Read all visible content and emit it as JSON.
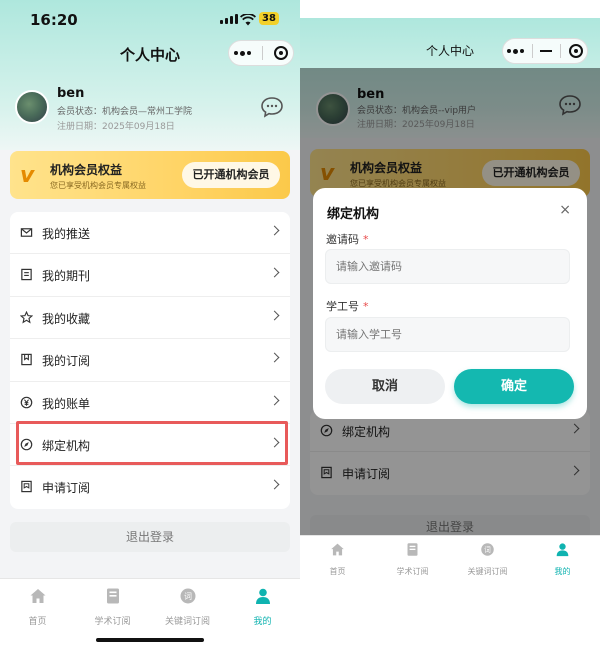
{
  "status_bar": {
    "time": "16:20",
    "battery": "38"
  },
  "header": {
    "title": "个人中心"
  },
  "profile": {
    "name": "ben",
    "member_status_left": "会员状态：机构会员—常州工学院",
    "member_status_right": "会员状态：机构会员--vip用户",
    "register_date": "注册日期：2025年09月18日"
  },
  "vip_card": {
    "logo": "v",
    "title": "机构会员权益",
    "subtitle": "您已享受机构会员专属权益",
    "button": "已开通机构会员"
  },
  "menu": {
    "items": [
      {
        "label": "我的推送",
        "icon": "mail-icon"
      },
      {
        "label": "我的期刊",
        "icon": "book-icon"
      },
      {
        "label": "我的收藏",
        "icon": "star-icon"
      },
      {
        "label": "我的订阅",
        "icon": "bookmark-icon"
      },
      {
        "label": "我的账单",
        "icon": "yuan-icon"
      },
      {
        "label": "绑定机构",
        "icon": "compass-icon"
      },
      {
        "label": "申请订阅",
        "icon": "apply-icon"
      }
    ]
  },
  "logout": "退出登录",
  "tabbar": {
    "items": [
      {
        "label": "首页",
        "icon": "home-icon"
      },
      {
        "label": "学术订阅",
        "icon": "document-icon"
      },
      {
        "label": "关键词订阅",
        "icon": "keyword-icon"
      },
      {
        "label": "我的",
        "icon": "user-icon"
      }
    ]
  },
  "modal": {
    "title": "绑定机构",
    "close": "×",
    "invite_label": "邀请码",
    "invite_placeholder": "请输入邀请码",
    "student_label": "学工号",
    "student_placeholder": "请输入学工号",
    "required_mark": "*",
    "cancel": "取消",
    "confirm": "确定"
  },
  "colors": {
    "accent": "#14b8b0",
    "header_gradient": "#aee7dd",
    "vip_gold": "#ffd466",
    "highlight_box": "#e85a5a"
  }
}
